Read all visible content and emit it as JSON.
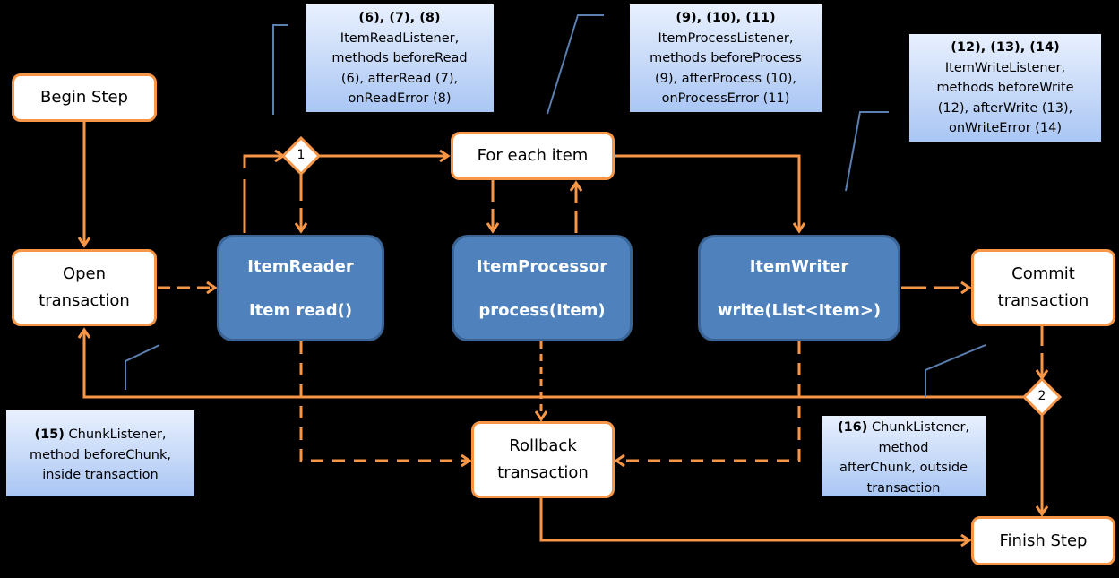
{
  "nodes": {
    "begin_step": "Begin Step",
    "open_tx_1": "Open",
    "open_tx_2": "transaction",
    "for_each": "For each item",
    "commit_1": "Commit",
    "commit_2": "transaction",
    "rollback_1": "Rollback",
    "rollback_2": "transaction",
    "finish_step": "Finish Step",
    "reader_title": "ItemReader",
    "reader_method": "Item read()",
    "processor_title": "ItemProcessor",
    "processor_method": "process(Item)",
    "writer_title": "ItemWriter",
    "writer_method": "write(List<Item>)"
  },
  "decisions": {
    "d1": "1",
    "d2": "2"
  },
  "notes": {
    "read": {
      "head": "(6), (7), (8)",
      "lines": [
        "ItemReadListener,",
        "methods beforeRead",
        "(6), afterRead (7),",
        "onReadError (8)"
      ]
    },
    "process": {
      "head": "(9), (10), (11)",
      "lines": [
        "ItemProcessListener,",
        "methods beforeProcess",
        "(9), afterProcess (10),",
        "onProcessError (11)"
      ]
    },
    "write": {
      "head": "(12), (13), (14)",
      "lines": [
        "ItemWriteListener,",
        "methods beforeWrite",
        "(12), afterWrite (13),",
        "onWriteError (14)"
      ]
    },
    "chunk_before": {
      "head": "(15)",
      "lines": [
        " ChunkListener,",
        "method beforeChunk,",
        "inside transaction"
      ]
    },
    "chunk_after": {
      "head": "(16)",
      "lines": [
        " ChunkListener,",
        "method",
        "afterChunk, outside",
        "transaction"
      ]
    }
  },
  "colors": {
    "flow": "#f79646",
    "component": "#4f81bd",
    "callout_line": "#5b7fb0"
  }
}
